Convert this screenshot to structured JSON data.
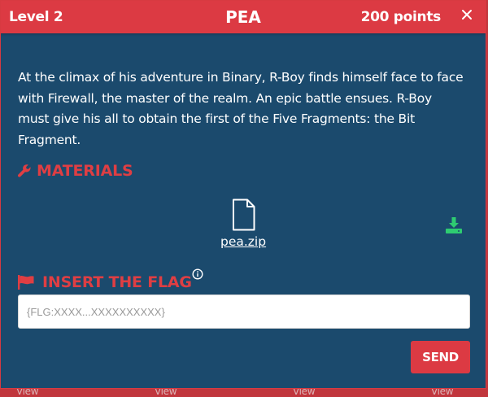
{
  "header": {
    "level": "Level 2",
    "title": "PEA",
    "points": "200 points"
  },
  "description": "At the climax of his adventure in Binary, R-Boy finds himself face to face with Firewall, the master of the realm. An epic battle ensues. R-Boy must give his all to obtain the first of the Five Fragments: the Bit Fragment.",
  "materials": {
    "heading": "MATERIALS",
    "file_name": "pea.zip"
  },
  "flag": {
    "heading": "INSERT THE FLAG",
    "placeholder": "{FLG:XXXX...XXXXXXXXXX}",
    "value": ""
  },
  "send_label": "SEND",
  "background_peek": [
    "View",
    "View",
    "View",
    "View"
  ],
  "colors": {
    "accent_red": "#dc3a43",
    "modal_bg": "#1b4a6d",
    "download_green": "#2ecc71"
  },
  "icons": {
    "close": "close-icon",
    "wrench": "wrench-icon",
    "file": "file-icon",
    "download": "download-icon",
    "flag": "flag-icon",
    "info": "info-icon"
  }
}
